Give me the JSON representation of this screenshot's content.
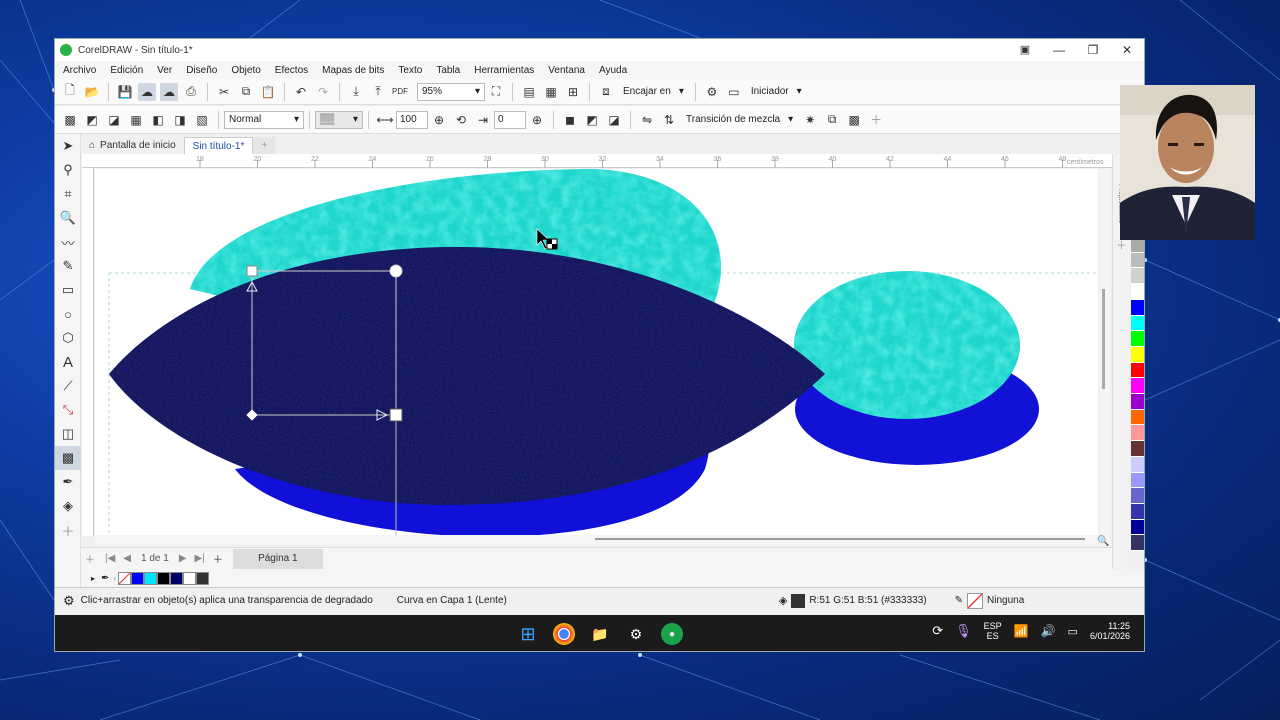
{
  "window": {
    "title": "CorelDRAW - Sin título-1*",
    "controls": [
      "—",
      "❐",
      "✕"
    ]
  },
  "menu": [
    "Archivo",
    "Edición",
    "Ver",
    "Diseño",
    "Objeto",
    "Efectos",
    "Mapas de bits",
    "Texto",
    "Tabla",
    "Herramientas",
    "Ventana",
    "Ayuda"
  ],
  "toolbar_main": {
    "zoom": "95%",
    "snap_label": "Encajar en",
    "launch_label": "Iniciador"
  },
  "toolbar_property": {
    "merge_mode": "Normal",
    "transparency": "100",
    "angle": "0",
    "blend_label": "Transición de mezcla"
  },
  "tabs": {
    "home": "Pantalla de inicio",
    "doc": "Sin título-1*",
    "add": "+"
  },
  "ruler": {
    "ticks": [
      "18",
      "20",
      "22",
      "24",
      "26",
      "28",
      "30",
      "32",
      "34",
      "36",
      "38",
      "40",
      "42",
      "44",
      "46",
      "48"
    ],
    "unit": "centímetros"
  },
  "page_nav": {
    "counter": "1 de 1",
    "page_tab": "Página 1"
  },
  "palette_colors": [
    "#aaaaaa",
    "#bbbbbb",
    "#d0d0d0",
    "#ffffff",
    "#0000ff",
    "#00ffff",
    "#00ff00",
    "#ffff00",
    "#ff0000",
    "#ff00ff",
    "#9900cc",
    "#ff6600",
    "#ff9999",
    "#663333",
    "#ccccff",
    "#9999ff",
    "#6666cc",
    "#3333aa",
    "#000099",
    "#333366"
  ],
  "doc_palette": [
    "#0000ff",
    "#00e5ff",
    "#000000",
    "#000066",
    "#ffffff",
    "#333333"
  ],
  "status": {
    "hint": "Clic+arrastrar en objeto(s) aplica una transparencia de degradado",
    "object": "Curva en Capa 1  (Lente)",
    "fill": "R:51 G:51 B:51 (#333333)",
    "outline": "Ninguna"
  },
  "taskbar": {
    "lang1": "ESP",
    "lang2": "ES",
    "time": "11:25",
    "date": "6/01/2026"
  }
}
